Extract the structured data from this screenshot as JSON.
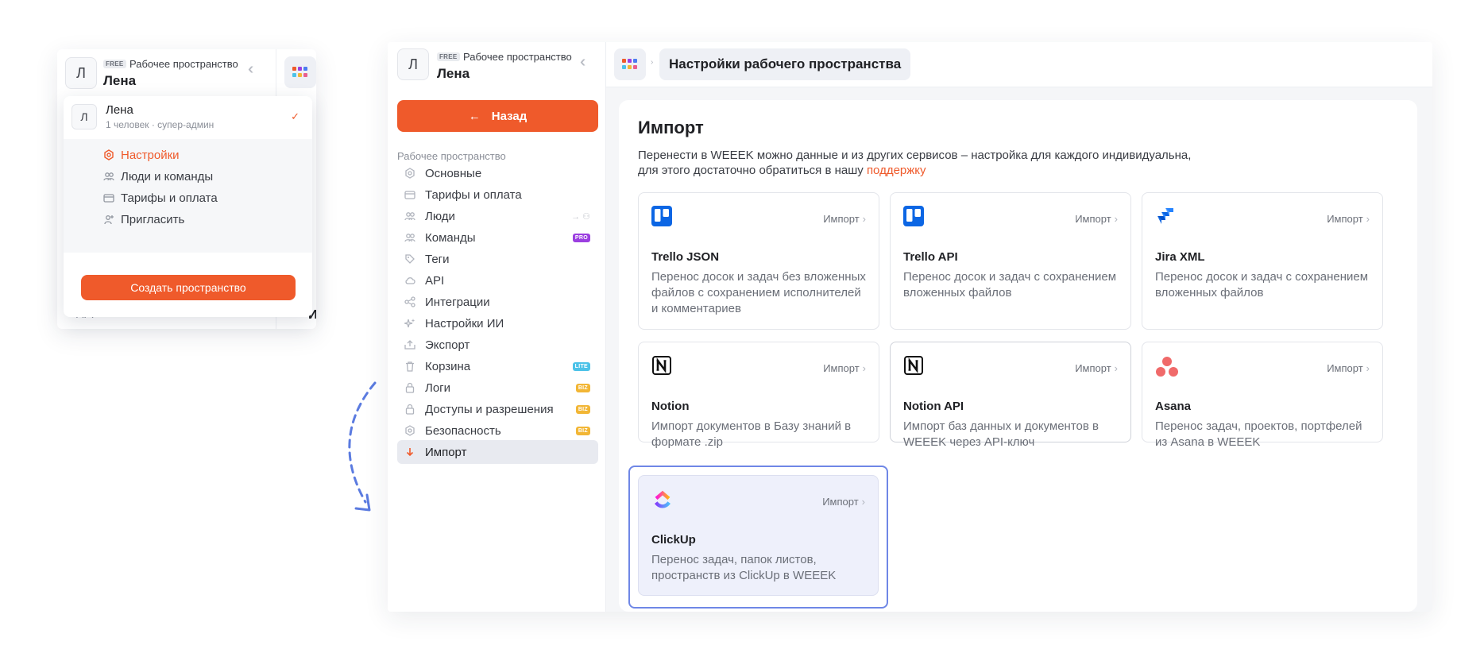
{
  "workspace": {
    "plan_badge": "FREE",
    "label": "Рабочее пространство",
    "name": "Лена",
    "avatar_letter": "Л"
  },
  "dropdown": {
    "user_name": "Лена",
    "user_meta": "1 человек · супер-админ",
    "check": "✓",
    "items": [
      {
        "label": "Настройки",
        "icon": "settings-icon",
        "active": true
      },
      {
        "label": "Люди и команды",
        "icon": "people-icon"
      },
      {
        "label": "Тарифы и оплата",
        "icon": "card-icon"
      },
      {
        "label": "Пригласить",
        "icon": "invite-icon"
      }
    ],
    "create_label": "Создать пространство",
    "behind_text_1": "API",
    "behind_text_2": "И"
  },
  "sidebar": {
    "back_label": "Назад",
    "section_title": "Рабочее пространство",
    "items": [
      {
        "label": "Основные",
        "icon": "settings-icon"
      },
      {
        "label": "Тарифы и оплата",
        "icon": "card-icon"
      },
      {
        "label": "Люди",
        "icon": "people-icon"
      },
      {
        "label": "Команды",
        "icon": "team-icon",
        "badge": "PRO"
      },
      {
        "label": "Теги",
        "icon": "tag-icon"
      },
      {
        "label": "API",
        "icon": "cloud-icon"
      },
      {
        "label": "Интеграции",
        "icon": "integrations-icon"
      },
      {
        "label": "Настройки ИИ",
        "icon": "sparkle-icon"
      },
      {
        "label": "Экспорт",
        "icon": "export-icon"
      },
      {
        "label": "Корзина",
        "icon": "trash-icon",
        "badge": "LITE"
      },
      {
        "label": "Логи",
        "icon": "lock-icon",
        "badge": "BIZ"
      },
      {
        "label": "Доступы и разрешения",
        "icon": "lock-icon",
        "badge": "BIZ"
      },
      {
        "label": "Безопасность",
        "icon": "shield-icon",
        "badge": "BIZ"
      },
      {
        "label": "Импорт",
        "icon": "download-icon",
        "active": true
      }
    ]
  },
  "colors": {
    "accent": "#ef5a2b",
    "badge_pro": "#9b3fe0",
    "badge_lite": "#4cc2e8",
    "badge_biz": "#f2b635",
    "selection": "#6f87e6"
  },
  "header": {
    "breadcrumb": "Настройки рабочего пространства"
  },
  "import": {
    "title": "Импорт",
    "desc_line1": "Перенести в WEEEK можно данные и из других сервисов – настройка для каждого индивидуальна,",
    "desc_line2": "для этого достаточно обратиться в нашу ",
    "desc_link": "поддержку",
    "action_label": "Импорт",
    "services": [
      {
        "name": "Trello JSON",
        "desc": "Перенос досок и задач без вложенных файлов с сохранением исполнителей и комментариев",
        "logo": "trello-logo"
      },
      {
        "name": "Trello API",
        "desc": "Перенос досок и задач с сохранением вложенных файлов",
        "logo": "trello-logo"
      },
      {
        "name": "Jira XML",
        "desc": "Перенос досок и задач с сохранением вложенных файлов",
        "logo": "jira-logo"
      },
      {
        "name": "Notion",
        "desc": "Импорт документов в Базу знаний в формате .zip",
        "logo": "notion-logo"
      },
      {
        "name": "Notion API",
        "desc": "Импорт баз данных и документов в WEEEK через API-ключ",
        "logo": "notion-logo"
      },
      {
        "name": "Asana",
        "desc": "Перенос задач, проектов, портфелей из Asana в WEEEK",
        "logo": "asana-logo"
      },
      {
        "name": "ClickUp",
        "desc": "Перенос задач, папок листов, пространств из ClickUp в WEEEK",
        "logo": "clickup-logo"
      }
    ]
  }
}
